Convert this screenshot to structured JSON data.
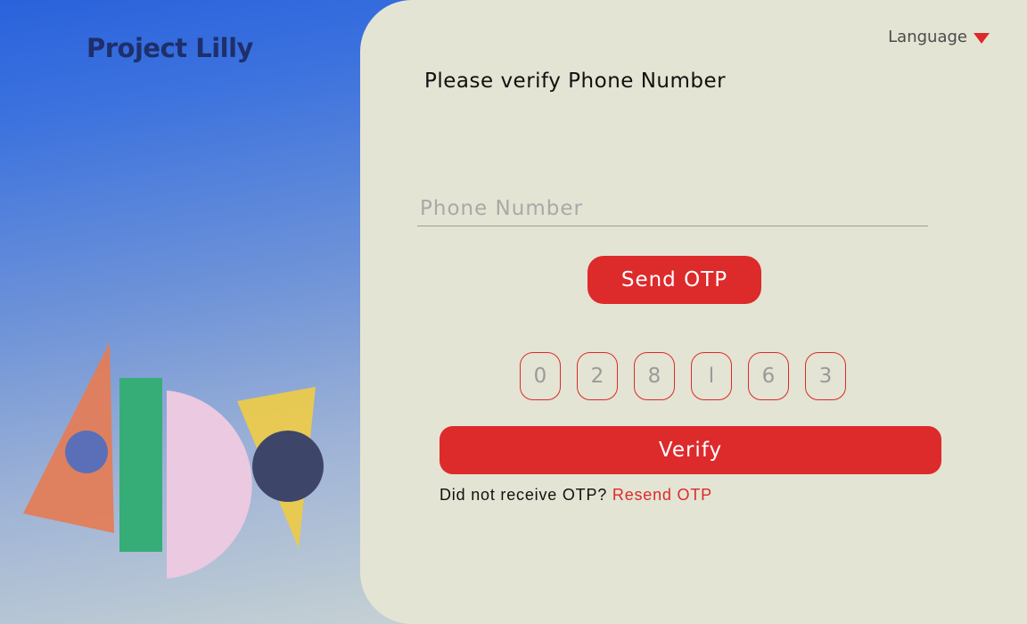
{
  "brand": {
    "title": "Project Lilly"
  },
  "header": {
    "language_label": "Language",
    "language_icon": "caret-down-icon"
  },
  "form": {
    "heading": "Please verify Phone Number",
    "phone_placeholder": "Phone Number",
    "phone_value": "",
    "send_otp_label": "Send OTP",
    "otp_digits": [
      "0",
      "2",
      "8",
      "l",
      "6",
      "3"
    ],
    "verify_label": "Verify",
    "resend_prompt": "Did not receive OTP?",
    "resend_link": "Resend OTP"
  },
  "colors": {
    "accent": "#dd2a2b",
    "panel_background": "#e3e4d3",
    "brand_text": "#1e2f6b"
  }
}
